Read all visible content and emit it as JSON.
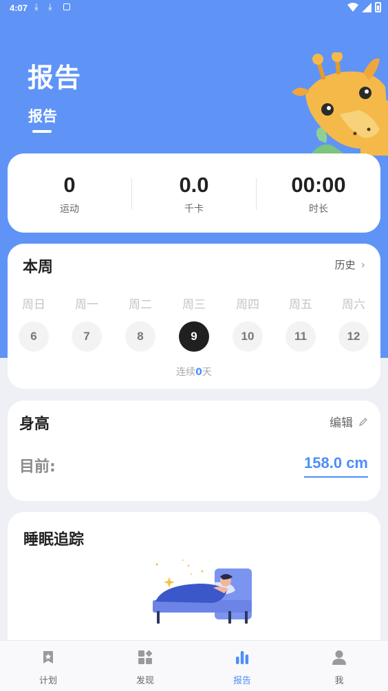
{
  "status_bar": {
    "time": "4:07"
  },
  "header": {
    "title": "报告",
    "tab_label": "报告"
  },
  "stats": [
    {
      "value": "0",
      "label": "运动"
    },
    {
      "value": "0.0",
      "label": "千卡"
    },
    {
      "value": "00:00",
      "label": "时长"
    }
  ],
  "week": {
    "title": "本周",
    "history_label": "历史",
    "days": [
      {
        "label": "周日",
        "date": "6"
      },
      {
        "label": "周一",
        "date": "7"
      },
      {
        "label": "周二",
        "date": "8"
      },
      {
        "label": "周三",
        "date": "9"
      },
      {
        "label": "周四",
        "date": "10"
      },
      {
        "label": "周五",
        "date": "11"
      },
      {
        "label": "周六",
        "date": "12"
      }
    ],
    "selected_day_index": 3,
    "streak_prefix": "连续",
    "streak_count": "0",
    "streak_suffix": "天"
  },
  "height": {
    "title": "身高",
    "edit_label": "编辑",
    "current_label": "目前:",
    "value": "158.0 cm"
  },
  "sleep": {
    "title": "睡眠追踪"
  },
  "tabbar": {
    "items": [
      {
        "label": "计划",
        "icon": "plan-star-icon"
      },
      {
        "label": "发现",
        "icon": "discover-grid-icon"
      },
      {
        "label": "报告",
        "icon": "report-bar-chart-icon"
      },
      {
        "label": "我",
        "icon": "profile-person-icon"
      }
    ],
    "active_index": 2
  },
  "colors": {
    "hero_blue": "#5f94f6",
    "accent_blue": "#4d8ef7",
    "background": "#eef0f5"
  }
}
